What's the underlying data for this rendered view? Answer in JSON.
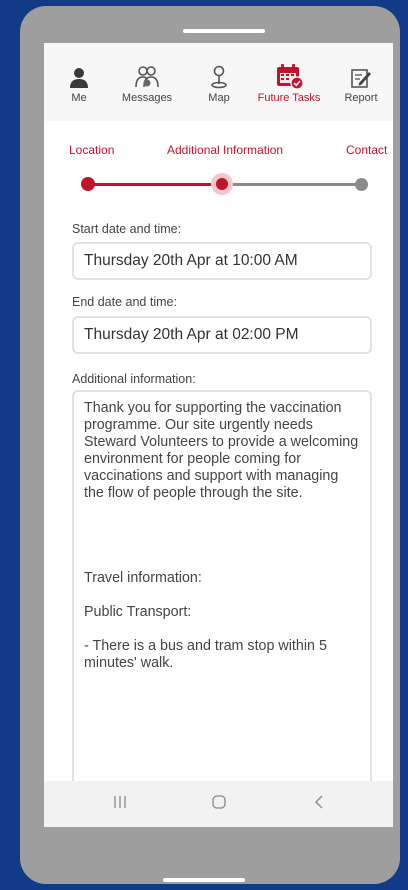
{
  "nav": {
    "items": [
      {
        "label": "Me",
        "icon": "person-icon"
      },
      {
        "label": "Messages",
        "icon": "people-icon"
      },
      {
        "label": "Map",
        "icon": "map-pin-icon"
      },
      {
        "label": "Future Tasks",
        "icon": "calendar-check-icon"
      },
      {
        "label": "Report",
        "icon": "report-edit-icon"
      }
    ],
    "active": "Future Tasks"
  },
  "stepper": {
    "steps": [
      "Location",
      "Additional Information",
      "Contact"
    ],
    "current_step": 2,
    "active_color": "#c0142a",
    "inactive_color": "#8a8a8a"
  },
  "form": {
    "start_label": "Start date and time:",
    "start_value": "Thursday 20th Apr at 10:00 AM",
    "end_label": "End date and time:",
    "end_value": "Thursday 20th Apr at 02:00 PM",
    "info_label": "Additional information:",
    "info_paragraphs": [
      "Thank you for supporting the vaccination programme. Our site urgently needs Steward Volunteers to provide a welcoming environment for people coming for vaccinations and support with managing the flow of people through the site.",
      "Travel information:",
      "Public Transport:",
      "- There is a bus and tram stop within 5 minutes' walk."
    ]
  },
  "system_nav": {
    "buttons": [
      "recent-apps-icon",
      "home-circle-icon",
      "back-chevron-icon"
    ]
  }
}
